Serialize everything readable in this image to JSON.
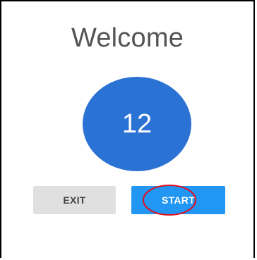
{
  "header": {
    "title": "Welcome"
  },
  "counter": {
    "value": "12",
    "color": "#2b72d5"
  },
  "buttons": {
    "exit_label": "EXIT",
    "start_label": "START"
  },
  "colors": {
    "start_button": "#2196f3",
    "exit_button": "#e0e0e0",
    "annotation_circle": "#e0101e"
  }
}
